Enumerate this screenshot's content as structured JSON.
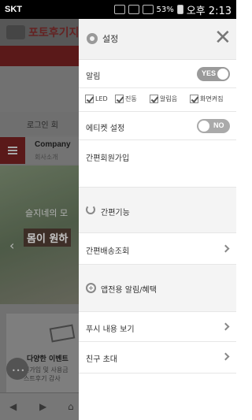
{
  "status_bar": {
    "carrier": "SKT",
    "battery": "53%",
    "time": "오후 2:13"
  },
  "background_page": {
    "logo_text": "포토후기지",
    "login_text": "로그인  회",
    "company_title": "Company",
    "company_sub": "회사소개",
    "hero_text_1": "슬지네의 모",
    "hero_text_2": "몸이 원하",
    "event_title": "다양한 이벤트",
    "event_desc": "원가입 및 사용금\n스트후기 감사"
  },
  "drawer": {
    "header_label": "설정",
    "notifications": {
      "label": "알림",
      "toggle": "YES"
    },
    "checkboxes": [
      {
        "label": "LED"
      },
      {
        "label": "진동"
      },
      {
        "label": "알림음"
      },
      {
        "label": "화면켜짐"
      }
    ],
    "etiquette": {
      "label": "에티켓 설정",
      "toggle": "NO"
    },
    "simple_signup": "간편회원가입",
    "simple_features": "간편기능",
    "simple_delivery": "간편배송조회",
    "app_only": "앱전용 알림/혜택",
    "push_view": "푸시 내용 보기",
    "invite": "친구 초대"
  }
}
